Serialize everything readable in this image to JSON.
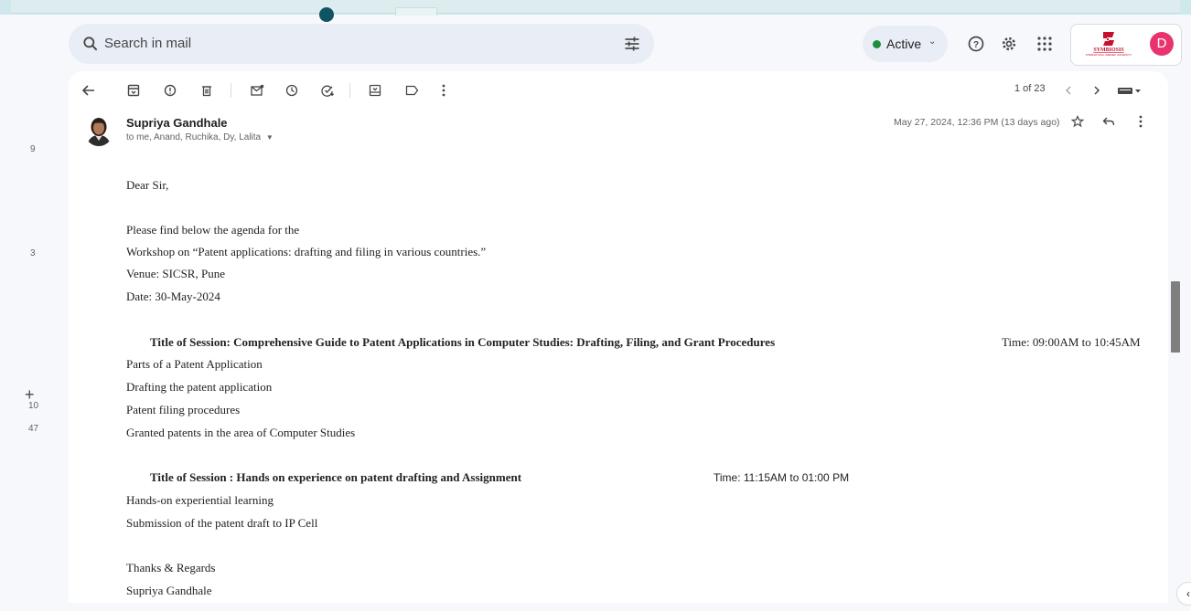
{
  "search": {
    "placeholder": "Search in mail"
  },
  "status": {
    "label": "Active"
  },
  "brand": {
    "logo_text": "SYMBIOSIS",
    "logo_sub": "INTERNATIONAL (DEEMED UNIVERSITY)"
  },
  "account": {
    "initial": "D"
  },
  "gutter": [
    "9",
    "3",
    "10",
    "47"
  ],
  "toolbar": {
    "pager": "1 of 23"
  },
  "message": {
    "sender": "Supriya Gandhale",
    "recipients": "to me, Anand, Ruchika, Dy, Lalita",
    "date": "May 27, 2024, 12:36 PM (13 days ago)"
  },
  "email": {
    "greeting": "Dear Sir,",
    "intro": "Please find below the agenda for the",
    "workshop": "Workshop on “Patent applications: drafting and filing in various countries.”",
    "venue": "Venue: SICSR, Pune",
    "date": "Date: 30-May-2024",
    "session1": {
      "title": "Title of Session:  Comprehensive Guide to Patent Applications in Computer Studies: Drafting, Filing, and Grant Procedures",
      "time": "Time: 09:00AM to 10:45AM",
      "items": [
        "Parts of a Patent Application",
        "Drafting the patent application",
        "Patent filing procedures",
        "Granted patents in the area of Computer Studies"
      ]
    },
    "session2": {
      "title": "Title of Session : Hands on experience on patent drafting and Assignment",
      "time": "Time: 11:15AM to 01:00 PM",
      "items": [
        "Hands-on experiential learning",
        "Submission of the patent draft to IP Cell"
      ]
    },
    "closing": "Thanks & Regards",
    "signature": "Supriya Gandhale"
  },
  "colors": {
    "accent_green": "#1e8e3e",
    "avatar_pink": "#e8336f",
    "brand_red": "#c8102e"
  }
}
